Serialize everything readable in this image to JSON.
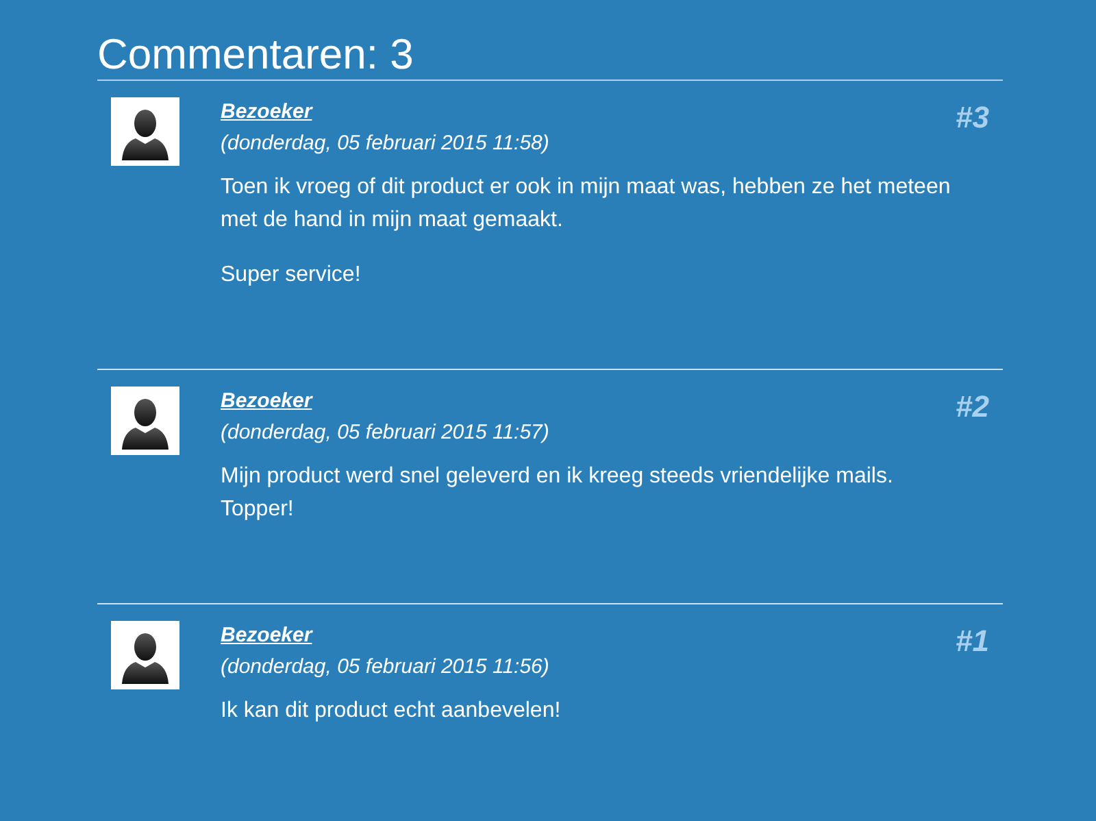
{
  "heading": "Commentaren: 3",
  "comments": [
    {
      "author": "Bezoeker",
      "date": "(donderdag, 05 februari 2015 11:58)",
      "number": "#3",
      "paragraphs": [
        "Toen ik vroeg of dit product er ook in mijn maat was, hebben ze het meteen met de hand in mijn maat gemaakt.",
        "Super service!"
      ]
    },
    {
      "author": "Bezoeker",
      "date": "(donderdag, 05 februari 2015 11:57)",
      "number": "#2",
      "paragraphs": [
        "Mijn product werd snel geleverd en ik kreeg steeds vriendelijke mails. Topper!"
      ]
    },
    {
      "author": "Bezoeker",
      "date": "(donderdag, 05 februari 2015 11:56)",
      "number": "#1",
      "paragraphs": [
        "Ik kan dit product echt aanbevelen!"
      ]
    }
  ]
}
